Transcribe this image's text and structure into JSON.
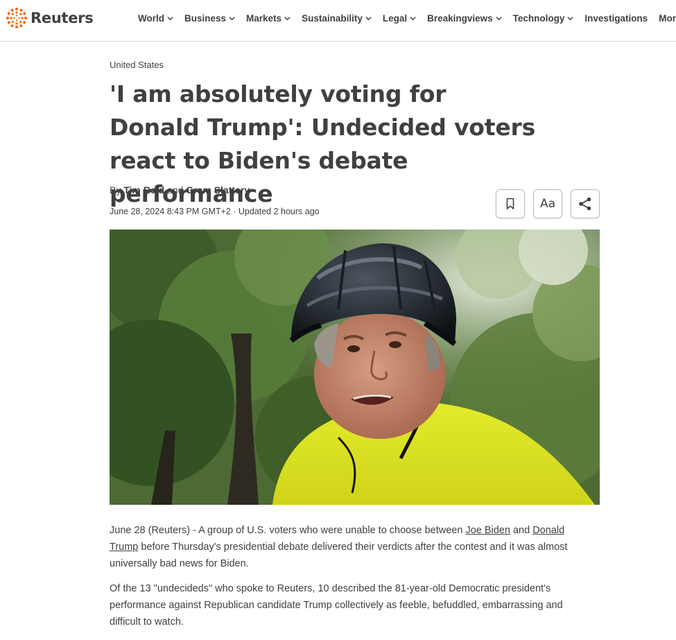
{
  "brand": {
    "name": "Reuters",
    "accent": "#fa6400"
  },
  "nav": {
    "items": [
      {
        "label": "World",
        "dropdown": true
      },
      {
        "label": "Business",
        "dropdown": true
      },
      {
        "label": "Markets",
        "dropdown": true
      },
      {
        "label": "Sustainability",
        "dropdown": true
      },
      {
        "label": "Legal",
        "dropdown": true
      },
      {
        "label": "Breakingviews",
        "dropdown": true
      },
      {
        "label": "Technology",
        "dropdown": true
      },
      {
        "label": "Investigations",
        "dropdown": false
      },
      {
        "label": "More",
        "dropdown": true
      }
    ]
  },
  "article": {
    "kicker": "United States",
    "headline": "'I am absolutely voting for Donald Trump': Undecided voters react to Biden's debate performance",
    "byline": {
      "prefix": "By ",
      "author1": "Tim Reid",
      "conj": " and ",
      "author2": "Gram Slattery"
    },
    "dateline": "June 28, 2024 8:43 PM GMT+2 · Updated 2 hours ago",
    "tools": {
      "bookmark_icon": "bookmark-icon",
      "text_size_label": "Aa",
      "share_icon": "share-icon"
    },
    "hero_image": {
      "description_icon": "photo",
      "alt": ""
    },
    "paragraphs": {
      "p1": {
        "lead": "June 28 (Reuters) - A group of U.S. voters who were unable to choose between ",
        "link1": "Joe Biden",
        "mid": " and ",
        "link2": "Donald Trump",
        "tail": " before Thursday's presidential debate delivered their verdicts after the contest and it was almost universally bad news for Biden."
      },
      "p2": "Of the 13 \"undecideds\" who spoke to Reuters, 10 described the 81-year-old Democratic president's performance against Republican candidate Trump collectively as feeble, befuddled, embarrassing and difficult to watch."
    }
  }
}
